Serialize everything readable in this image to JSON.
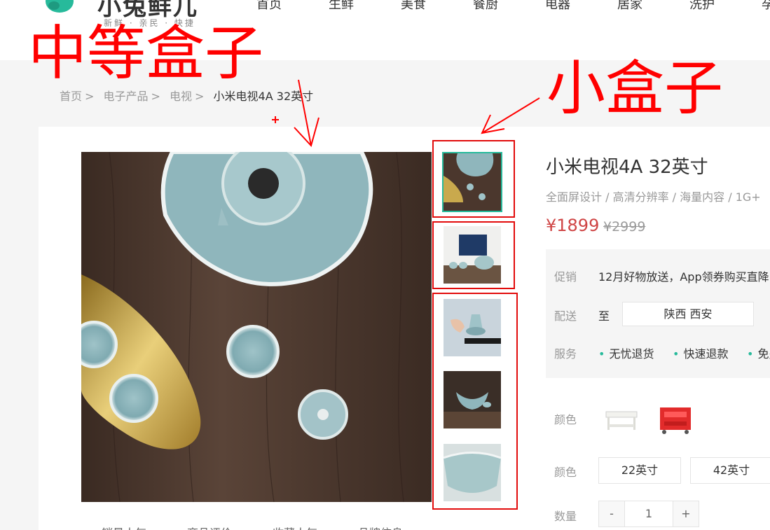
{
  "header": {
    "logo_text": "小兔鲜儿",
    "logo_sub": "新鲜 · 亲民 · 快捷",
    "nav": [
      "首页",
      "生鲜",
      "美食",
      "餐厨",
      "电器",
      "居家",
      "洗护",
      "孕"
    ]
  },
  "breadcrumb": [
    "首页",
    "电子产品",
    "电视",
    "小米电视4A 32英寸"
  ],
  "product": {
    "name": "小米电视4A 32英寸",
    "desc": "全面屏设计 / 高清分辨率 / 海量内容 / 1G+",
    "price": "¥1899",
    "old_price": "¥2999"
  },
  "info": {
    "promo_label": "促销",
    "promo_text": "12月好物放送，App领券购买直降",
    "delivery_label": "配送",
    "delivery_to": "至",
    "delivery_addr": "陕西 西安",
    "service_label": "服务",
    "services": [
      "无忧退货",
      "快速退款",
      "免费"
    ]
  },
  "options": {
    "color_label": "颜色",
    "size_label": "颜色",
    "sizes": [
      "22英寸",
      "42英寸"
    ],
    "qty_label": "数量",
    "qty": "1",
    "minus": "-",
    "plus": "+"
  },
  "bottom_tabs": [
    "销量人气",
    "商品评价",
    "收藏人气",
    "品牌信息"
  ],
  "annotations": {
    "medium": "中等盒子",
    "small": "小盒子"
  },
  "colors": {
    "accent": "#27ba9b",
    "price": "#cf4444",
    "annotation": "#ff0000"
  }
}
